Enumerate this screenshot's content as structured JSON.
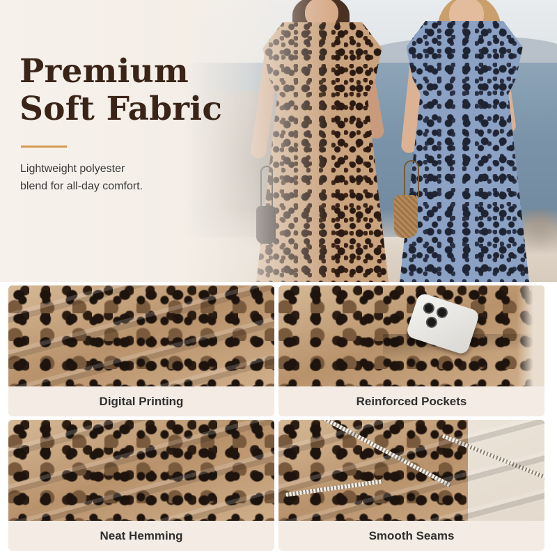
{
  "hero": {
    "title_line1": "Premium",
    "title_line2": "Soft Fabric",
    "subtitle_line1": "Lightweight polyester",
    "subtitle_line2": "blend for all-day comfort."
  },
  "features": [
    {
      "label": "Digital Printing"
    },
    {
      "label": "Reinforced Pockets"
    },
    {
      "label": "Neat Hemming"
    },
    {
      "label": "Smooth Seams"
    }
  ],
  "colors": {
    "title": "#3a2418",
    "accent_divider": "#d59a52",
    "label_bar": "#f3ebe4",
    "dress_brown": "#c9a37e",
    "dress_blue": "#8ba2c4"
  }
}
